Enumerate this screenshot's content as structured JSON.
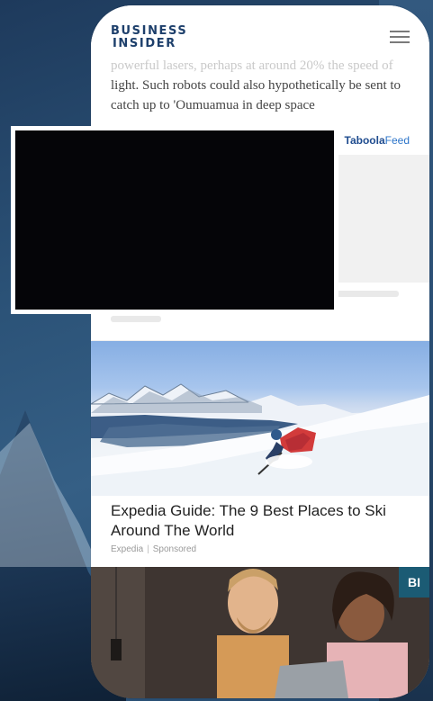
{
  "header": {
    "logo_line1": "BUSINESS",
    "logo_line2": "INSIDER",
    "menu_icon": "hamburger-menu-icon"
  },
  "article": {
    "faded_line": "powerful lasers, perhaps at around 20% the speed of",
    "text": "light. Such robots could also hypothetically be sent to catch up to 'Oumuamua in deep space"
  },
  "taboola": {
    "brand": "Taboola",
    "feed": "Feed"
  },
  "ads": [
    {
      "title": "Expedia Guide: The 9 Best Places to Ski Around The World",
      "source": "Expedia",
      "label": "Sponsored",
      "image": "skier-on-snowy-mountain"
    },
    {
      "badge": "BI",
      "image": "two-people-laughing-at-laptop"
    }
  ],
  "colors": {
    "brand_navy": "#1d3f6b",
    "taboola_blue": "#2b74c9",
    "bi_teal": "#1b5b74"
  }
}
